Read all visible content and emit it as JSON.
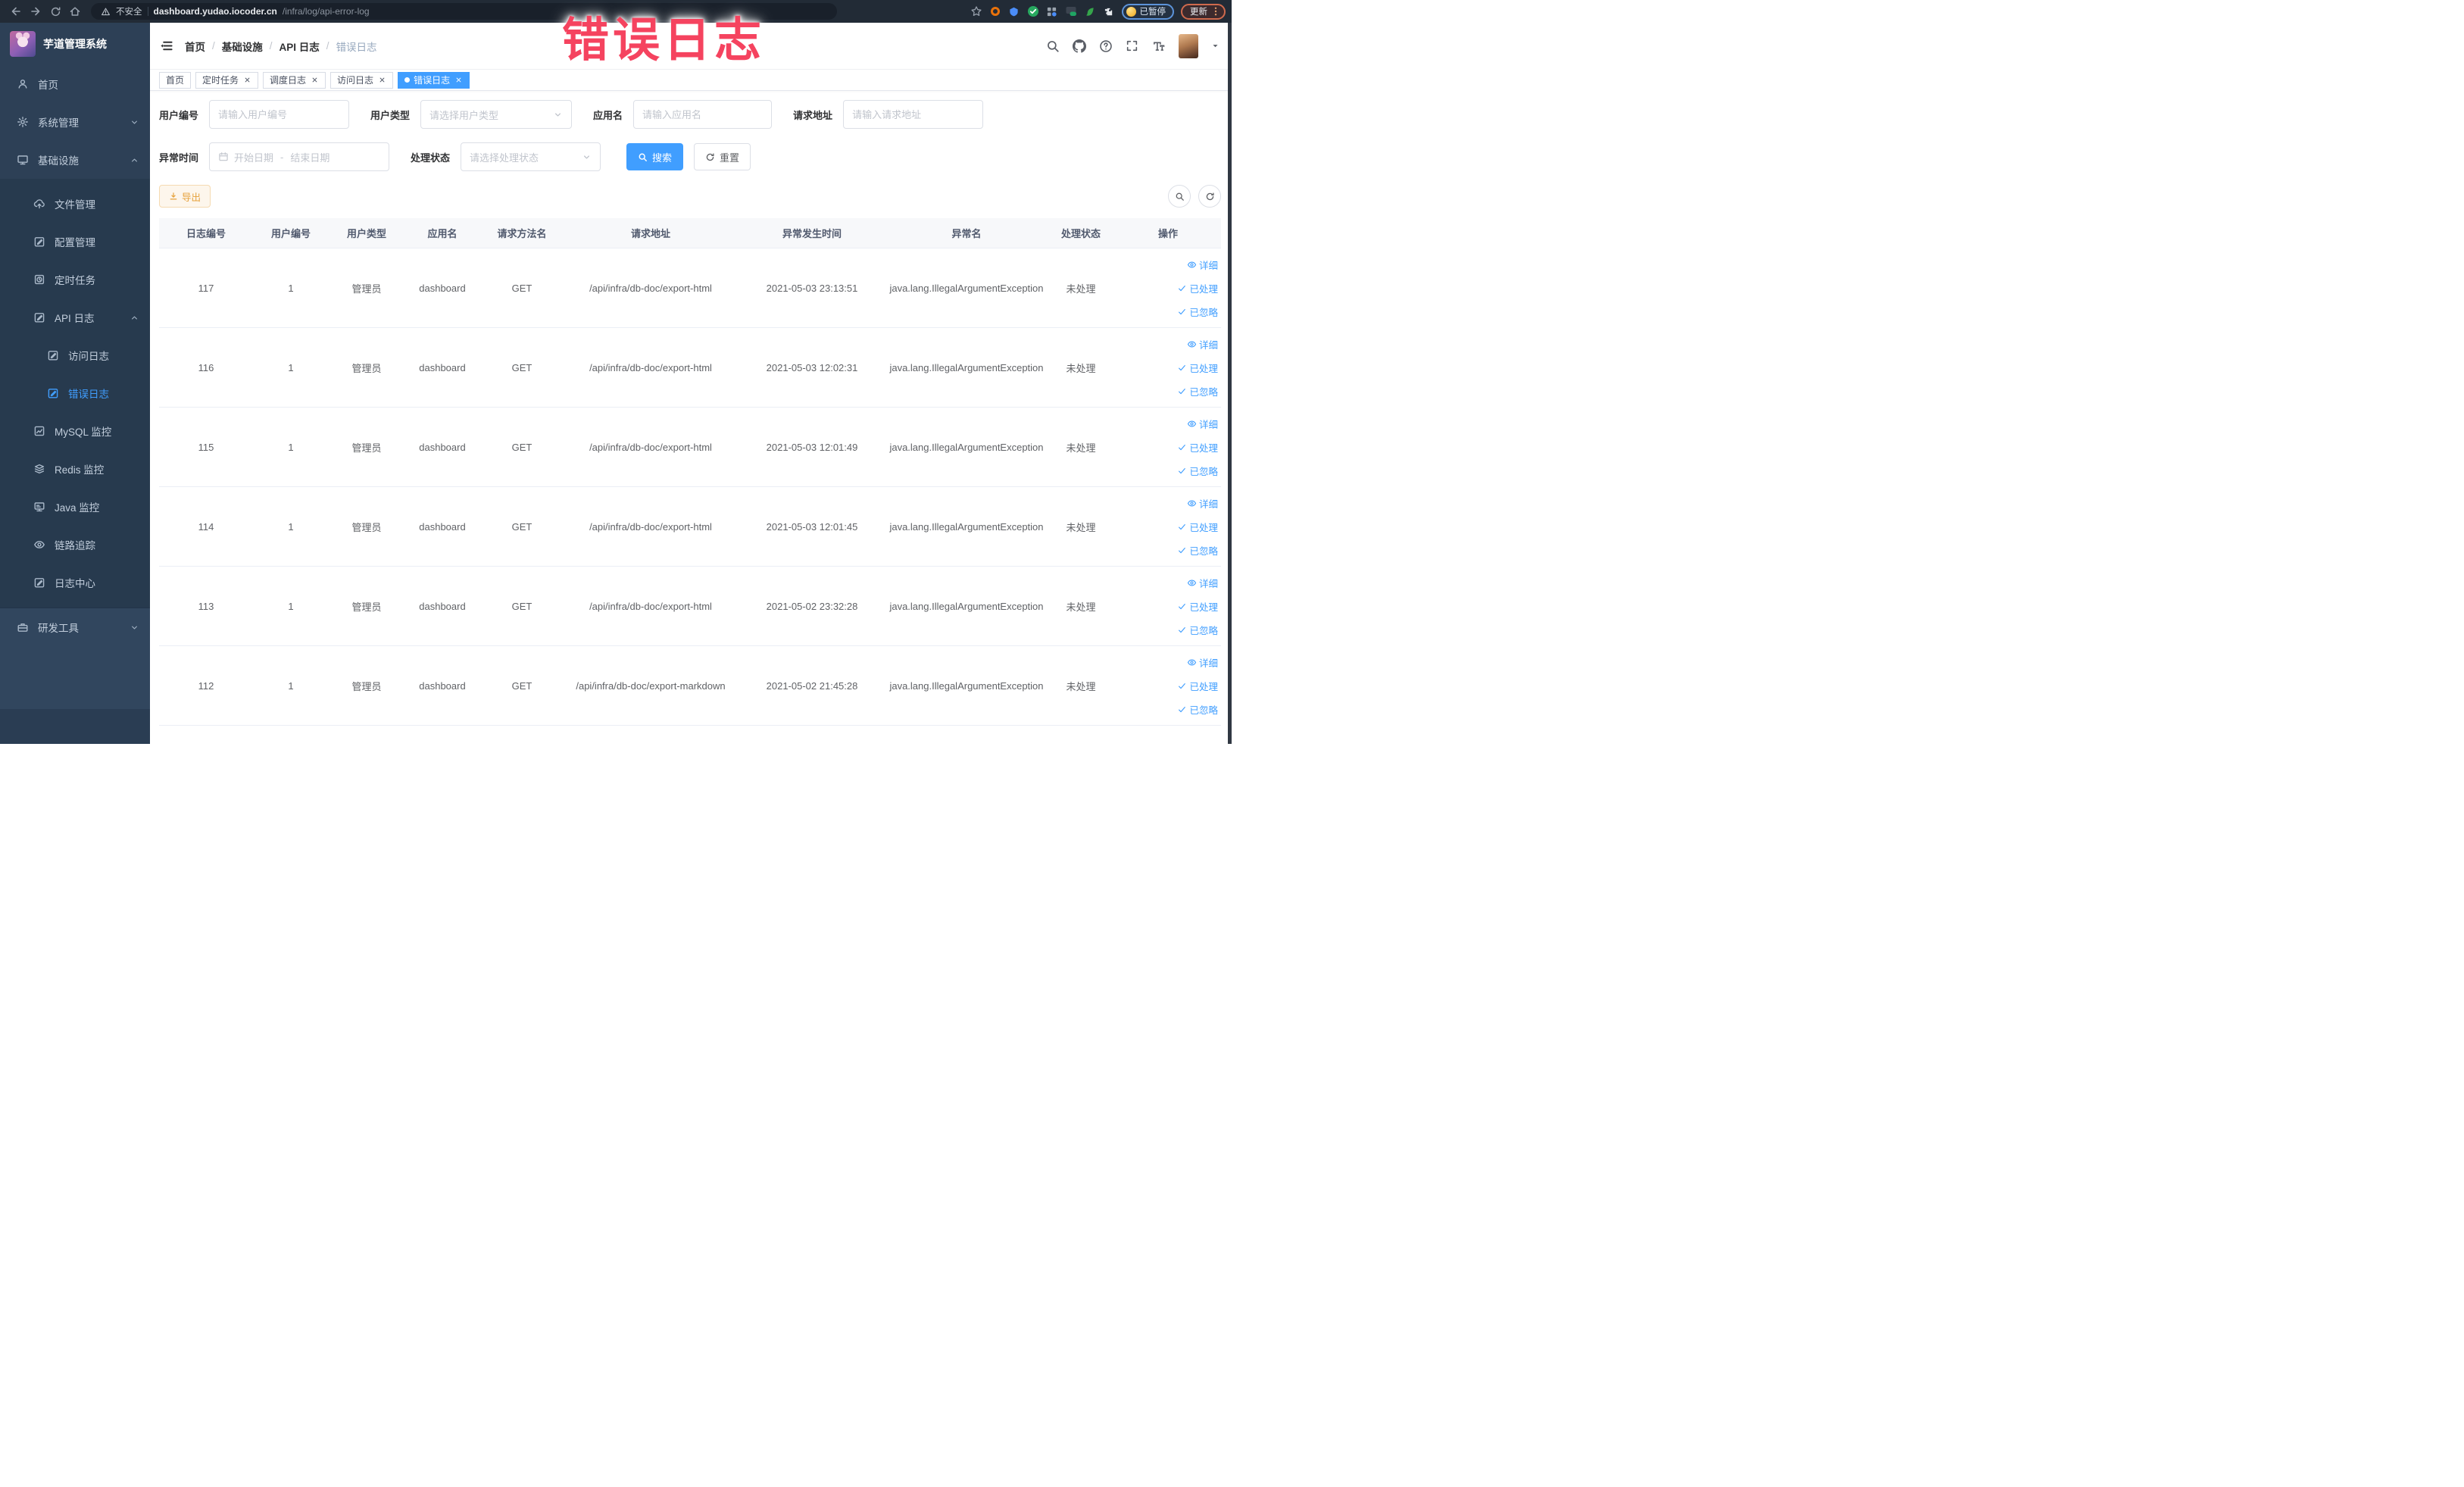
{
  "colors": {
    "primary": "#409eff",
    "annotation_red": "#f5435f",
    "warning_text": "#e6a23c",
    "sidebar_bg": "#2d4056",
    "sidebar_sub_bg": "#273a4e",
    "active_tab_bg": "#409eff"
  },
  "annotation": {
    "text": "错误日志"
  },
  "browser": {
    "toolbar_icons": [
      "back-icon",
      "forward-icon",
      "reload-icon",
      "home-icon"
    ],
    "security_label": "不安全",
    "url_host": "dashboard.yudao.iocoder.cn",
    "url_path": "/infra/log/api-error-log",
    "bookmark_icon": "star-icon",
    "extension_icons": [
      "target-icon",
      "shield-icon",
      "check-circle-icon",
      "grid-icon",
      "on-badge-icon",
      "leaf-icon",
      "puzzle-icon"
    ],
    "paused_badge": "已暂停",
    "update_badge": "更新",
    "menu_icon": "kebab-menu-icon"
  },
  "sidebar": {
    "logo_title": "芋道管理系统",
    "items": [
      {
        "label": "首页",
        "icon": "people",
        "level": 1,
        "group": "top"
      },
      {
        "label": "系统管理",
        "icon": "gear",
        "level": 1,
        "group": "top",
        "chevron": "down"
      },
      {
        "label": "基础设施",
        "icon": "monitor",
        "level": 1,
        "group": "top",
        "chevron": "up"
      },
      {
        "label": "文件管理",
        "icon": "cloud-up",
        "level": 2,
        "group": "sub"
      },
      {
        "label": "配置管理",
        "icon": "edit",
        "level": 2,
        "group": "sub"
      },
      {
        "label": "定时任务",
        "icon": "timer",
        "level": 2,
        "group": "sub"
      },
      {
        "label": "API 日志",
        "icon": "edit",
        "level": 2,
        "group": "sub",
        "chevron": "up"
      },
      {
        "label": "访问日志",
        "icon": "edit",
        "level": 3,
        "group": "sub"
      },
      {
        "label": "错误日志",
        "icon": "edit",
        "level": 3,
        "group": "sub",
        "active": true
      },
      {
        "label": "MySQL 监控",
        "icon": "chart",
        "level": 2,
        "group": "sub"
      },
      {
        "label": "Redis 监控",
        "icon": "layers",
        "level": 2,
        "group": "sub"
      },
      {
        "label": "Java 监控",
        "icon": "screen",
        "level": 2,
        "group": "sub"
      },
      {
        "label": "链路追踪",
        "icon": "eye",
        "level": 2,
        "group": "sub"
      },
      {
        "label": "日志中心",
        "icon": "edit",
        "level": 2,
        "group": "sub"
      },
      {
        "label": "研发工具",
        "icon": "toolbox",
        "level": 1,
        "group": "bottom",
        "chevron": "down"
      }
    ]
  },
  "header": {
    "breadcrumb": [
      "首页",
      "基础设施",
      "API 日志",
      "错误日志"
    ],
    "right_icons": [
      "search-icon",
      "github-icon",
      "help-icon",
      "fullscreen-icon",
      "font-size-icon"
    ]
  },
  "tabs": [
    {
      "label": "首页",
      "closable": false,
      "active": false
    },
    {
      "label": "定时任务",
      "closable": true,
      "active": false
    },
    {
      "label": "调度日志",
      "closable": true,
      "active": false
    },
    {
      "label": "访问日志",
      "closable": true,
      "active": false
    },
    {
      "label": "错误日志",
      "closable": true,
      "active": true
    }
  ],
  "filters": {
    "row1": [
      {
        "label": "用户编号",
        "placeholder": "请输入用户编号",
        "type": "input"
      },
      {
        "label": "用户类型",
        "placeholder": "请选择用户类型",
        "type": "select"
      },
      {
        "label": "应用名",
        "placeholder": "请输入应用名",
        "type": "input"
      },
      {
        "label": "请求地址",
        "placeholder": "请输入请求地址",
        "type": "input"
      }
    ],
    "time_label": "异常时间",
    "date_start_placeholder": "开始日期",
    "date_separator": "-",
    "date_end_placeholder": "结束日期",
    "status_label": "处理状态",
    "status_placeholder": "请选择处理状态",
    "search_label": "搜索",
    "reset_label": "重置"
  },
  "toolbar": {
    "export_label": "导出"
  },
  "table": {
    "headers": [
      "日志编号",
      "用户编号",
      "用户类型",
      "应用名",
      "请求方法名",
      "请求地址",
      "异常发生时间",
      "异常名",
      "处理状态",
      "操作"
    ],
    "action_labels": [
      "详细",
      "已处理",
      "已忽略"
    ],
    "rows": [
      {
        "id": "117",
        "user_id": "1",
        "user_type": "管理员",
        "app_name": "dashboard",
        "method": "GET",
        "url": "/api/infra/db-doc/export-html",
        "time": "2021-05-03 23:13:51",
        "exception": "java.lang.IllegalArgumentException",
        "status": "未处理"
      },
      {
        "id": "116",
        "user_id": "1",
        "user_type": "管理员",
        "app_name": "dashboard",
        "method": "GET",
        "url": "/api/infra/db-doc/export-html",
        "time": "2021-05-03 12:02:31",
        "exception": "java.lang.IllegalArgumentException",
        "status": "未处理"
      },
      {
        "id": "115",
        "user_id": "1",
        "user_type": "管理员",
        "app_name": "dashboard",
        "method": "GET",
        "url": "/api/infra/db-doc/export-html",
        "time": "2021-05-03 12:01:49",
        "exception": "java.lang.IllegalArgumentException",
        "status": "未处理"
      },
      {
        "id": "114",
        "user_id": "1",
        "user_type": "管理员",
        "app_name": "dashboard",
        "method": "GET",
        "url": "/api/infra/db-doc/export-html",
        "time": "2021-05-03 12:01:45",
        "exception": "java.lang.IllegalArgumentException",
        "status": "未处理"
      },
      {
        "id": "113",
        "user_id": "1",
        "user_type": "管理员",
        "app_name": "dashboard",
        "method": "GET",
        "url": "/api/infra/db-doc/export-html",
        "time": "2021-05-02 23:32:28",
        "exception": "java.lang.IllegalArgumentException",
        "status": "未处理"
      },
      {
        "id": "112",
        "user_id": "1",
        "user_type": "管理员",
        "app_name": "dashboard",
        "method": "GET",
        "url": "/api/infra/db-doc/export-markdown",
        "time": "2021-05-02 21:45:28",
        "exception": "java.lang.IllegalArgumentException",
        "status": "未处理"
      }
    ]
  }
}
